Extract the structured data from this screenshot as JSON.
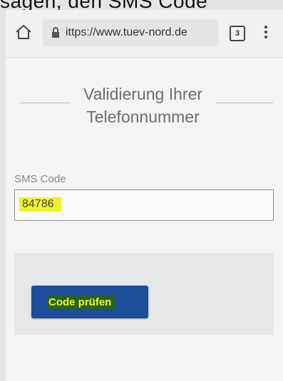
{
  "caption": "sagen, den SMS Code",
  "browser": {
    "url": "ittps://www.tuev-nord.de",
    "tab_count": "3"
  },
  "page": {
    "heading_line1": "Validierung Ihrer",
    "heading_line2": "Telefonnummer",
    "sms_label": "SMS Code",
    "sms_value": "84786",
    "button_label": "Code prüfen"
  },
  "colors": {
    "button": "#1d4e9a",
    "highlight": "#eef52a"
  }
}
